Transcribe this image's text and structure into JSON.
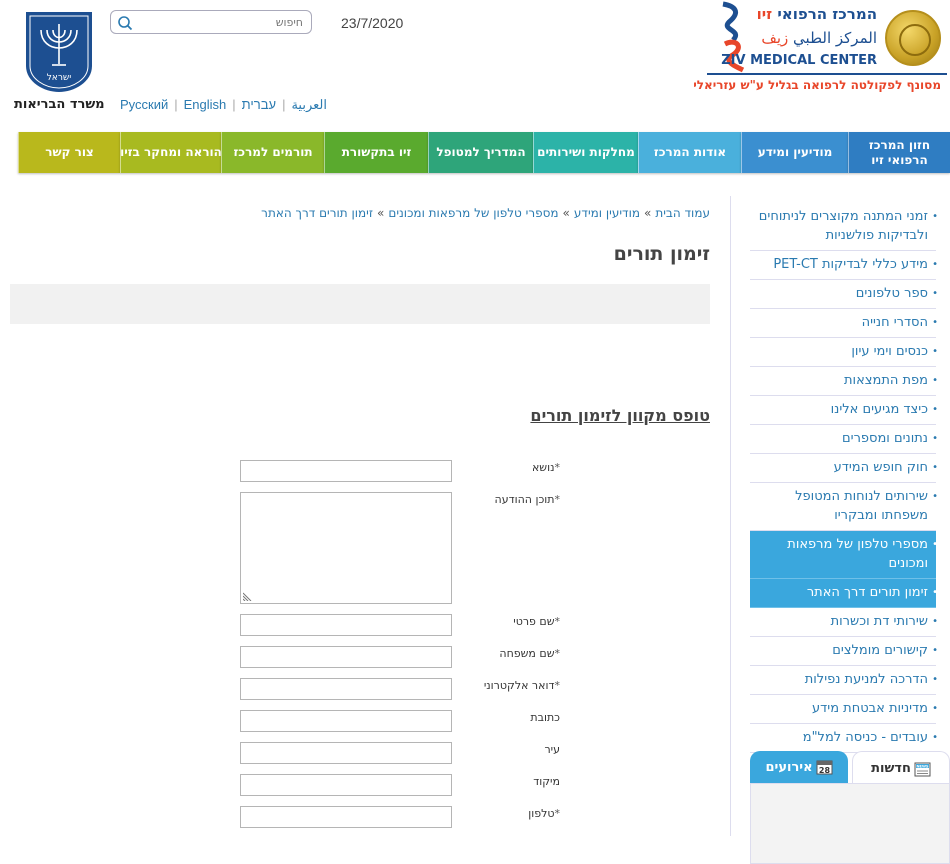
{
  "header": {
    "logo_he": "המרכז הרפואי",
    "logo_he_name": "זיו",
    "logo_ar": "المركز الطبي",
    "logo_ar_name": "زيف",
    "logo_en": "ZIV MEDICAL CENTER",
    "logo_tagline": "מסונף לפקולטה לרפואה בגליל ע\"ש עזריאלי",
    "date": "23/7/2020",
    "search_placeholder": "חיפוש",
    "ministry": "משרד הבריאות",
    "emblem_text": "ישראל",
    "languages": [
      "Русский",
      "English",
      "العربية",
      "עברית"
    ]
  },
  "nav": {
    "items": [
      {
        "label": "חזון המרכז הרפואי זיו",
        "color": "#2f7dc2"
      },
      {
        "label": "מודיעין ומידע",
        "color": "#3b8fd0"
      },
      {
        "label": "אודות המרכז",
        "color": "#4ab0dc"
      },
      {
        "label": "מחלקות ושירותים",
        "color": "#2cb3a8"
      },
      {
        "label": "המדריך למטופל",
        "color": "#2ea57a"
      },
      {
        "label": "זיו בתקשורת",
        "color": "#5aaa2e"
      },
      {
        "label": "תורמים למרכז",
        "color": "#8ab82a"
      },
      {
        "label": "הוראה ומחקר בזיו",
        "color": "#a8ba20"
      },
      {
        "label": "צור קשר",
        "color": "#b9b81c"
      }
    ]
  },
  "breadcrumb": {
    "home": "עמוד הבית",
    "level1": "מודיעין ומידע",
    "level2": "מספרי טלפון של מרפאות ומכונים",
    "current": "זימון תורים דרך האתר"
  },
  "main": {
    "page_title": "זימון תורים",
    "form_title": "טופס מקוון לזימון תורים",
    "fields": [
      {
        "label": "נושא",
        "required": "*"
      },
      {
        "label": "תוכן ההודעה",
        "required": "*"
      },
      {
        "label": "שם פרטי",
        "required": "*"
      },
      {
        "label": "שם משפחה",
        "required": "*"
      },
      {
        "label": "דואר אלקטרוני",
        "required": "*"
      },
      {
        "label": "כתובת",
        "required": ""
      },
      {
        "label": "עיר",
        "required": ""
      },
      {
        "label": "מיקוד",
        "required": ""
      },
      {
        "label": "טלפון",
        "required": "*"
      }
    ]
  },
  "sidebar": {
    "items": [
      {
        "label": "זמני המתנה מקוצרים לניתוחים ולבדיקות פולשניות",
        "active": false
      },
      {
        "label": "מידע כללי לבדיקות PET-CT",
        "active": false
      },
      {
        "label": "ספר טלפונים",
        "active": false
      },
      {
        "label": "הסדרי חנייה",
        "active": false
      },
      {
        "label": "כנסים וימי עיון",
        "active": false
      },
      {
        "label": "מפת התמצאות",
        "active": false
      },
      {
        "label": "כיצד מגיעים אלינו",
        "active": false
      },
      {
        "label": "נתונים ומספרים",
        "active": false
      },
      {
        "label": "חוק חופש המידע",
        "active": false
      },
      {
        "label": "שירותים לנוחות המטופל משפחתו ומבקריו",
        "active": false
      },
      {
        "label": "מספרי טלפון של מרפאות ומכונים",
        "active": true
      },
      {
        "label": "זימון תורים דרך האתר",
        "active": true
      },
      {
        "label": "שירותי דת וכשרות",
        "active": false
      },
      {
        "label": "קישורים מומלצים",
        "active": false
      },
      {
        "label": "הדרכה למניעת נפילות",
        "active": false
      },
      {
        "label": "מדיניות אבטחת מידע",
        "active": false
      },
      {
        "label": "עובדים - כניסה למל\"מ",
        "active": false
      }
    ],
    "tabs": {
      "news": "חדשות",
      "events": "אירועים",
      "news_icon_text": "NEWS",
      "events_icon_text": "28"
    }
  }
}
